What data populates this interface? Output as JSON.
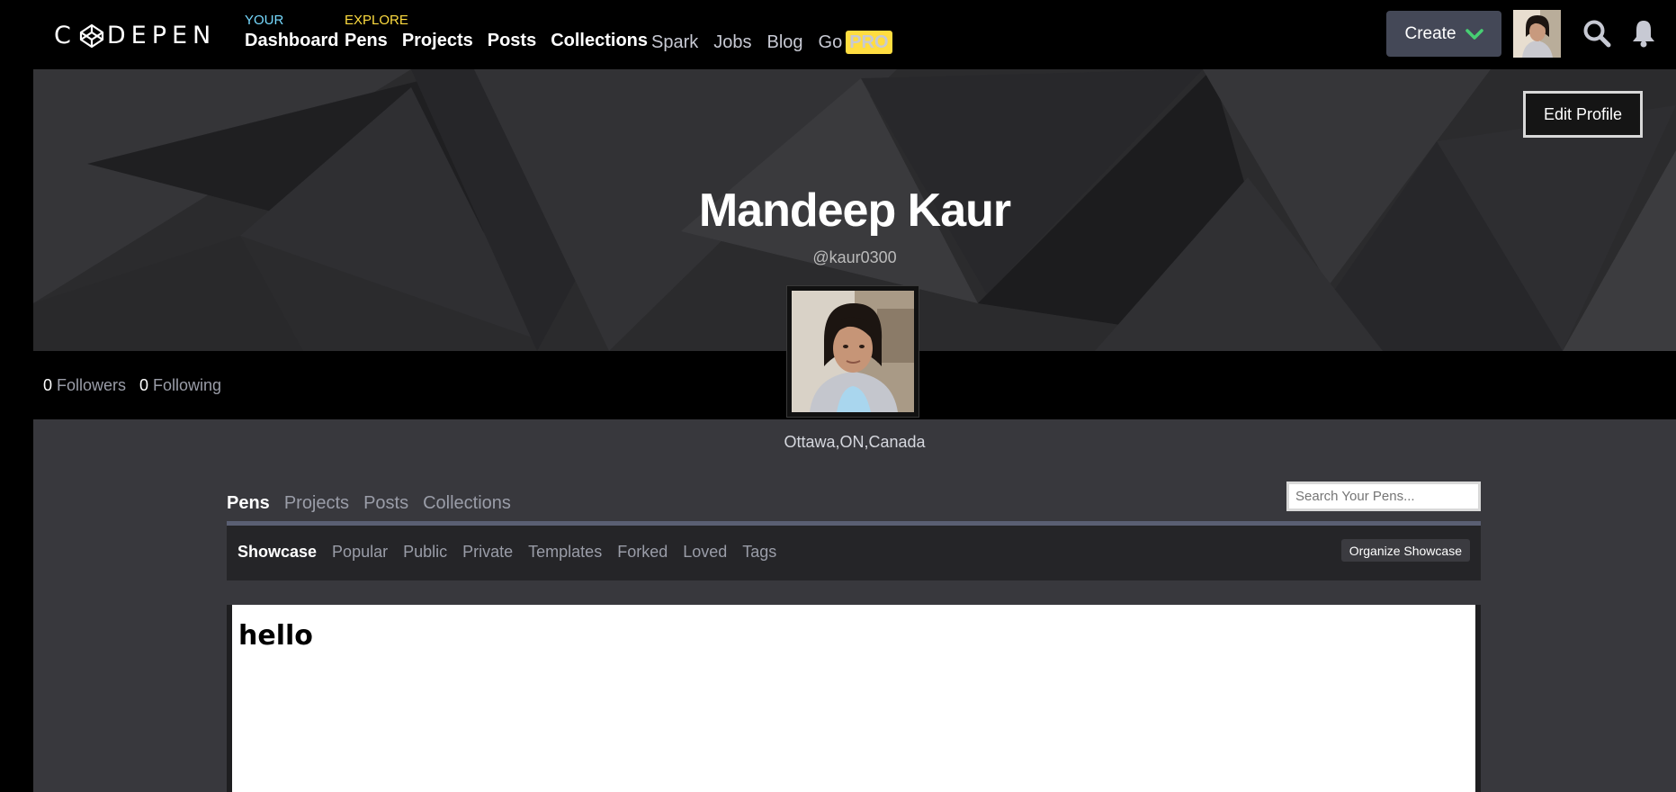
{
  "header": {
    "logo_text": "CODEPEN",
    "your_label": "YOUR",
    "your_links": [
      "Dashboard"
    ],
    "explore_label": "EXPLORE",
    "explore_links": [
      "Pens",
      "Projects",
      "Posts",
      "Collections"
    ],
    "secondary_links": [
      "Spark",
      "Jobs",
      "Blog"
    ],
    "go_label": "Go",
    "pro_badge": "PRO",
    "create_label": "Create"
  },
  "profile": {
    "edit_label": "Edit Profile",
    "name": "Mandeep Kaur",
    "handle": "@kaur0300",
    "followers_count": "0",
    "followers_label": "Followers",
    "following_count": "0",
    "following_label": "Following",
    "location": "Ottawa,ON,Canada"
  },
  "tabs": [
    "Pens",
    "Projects",
    "Posts",
    "Collections"
  ],
  "search": {
    "placeholder": "Search Your Pens..."
  },
  "subtabs": [
    "Showcase",
    "Popular",
    "Public",
    "Private",
    "Templates",
    "Forked",
    "Loved",
    "Tags"
  ],
  "organize_label": "Organize Showcase",
  "preview": {
    "heading": "hello"
  },
  "colors": {
    "accent_green": "#47cf73",
    "your_blue": "#76daff",
    "explore_yellow": "#ffdd40",
    "background": "#000000",
    "content_bg": "#38383d"
  },
  "icons": [
    "codepen-logo-icon",
    "chevron-down-icon",
    "search-icon",
    "bell-icon"
  ]
}
